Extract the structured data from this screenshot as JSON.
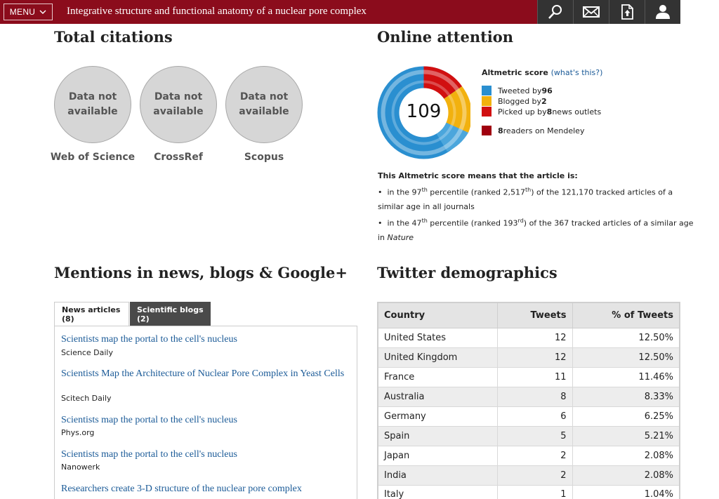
{
  "header": {
    "menu_label": "MENU",
    "title": "Integrative structure and functional anatomy of a nuclear pore complex",
    "icons": [
      "search-icon",
      "mail-icon",
      "download-icon",
      "user-icon"
    ]
  },
  "citations": {
    "heading": "Total citations",
    "items": [
      {
        "value": "Data not available",
        "label": "Web of Science"
      },
      {
        "value": "Data not available",
        "label": "CrossRef"
      },
      {
        "value": "Data not available",
        "label": "Scopus"
      }
    ]
  },
  "attention": {
    "heading": "Online attention",
    "score": "109",
    "score_title": "Altmetric score",
    "whats_this": "(what's this?)",
    "legend": [
      {
        "pre": "Tweeted by ",
        "bold": "96",
        "post": "",
        "color": "#2a8fd0"
      },
      {
        "pre": "Blogged by ",
        "bold": "2",
        "post": "",
        "color": "#f2b10e"
      },
      {
        "pre": "Picked up by ",
        "bold": "8",
        "post": " news outlets",
        "color": "#d10f10"
      },
      {
        "pre": "",
        "bold": "8",
        "post": " readers on Mendeley",
        "color": "#a0000f"
      }
    ],
    "means_title": "This Altmetric score means that the article is:",
    "line1_a": "in the 97",
    "line1_sup1": "th",
    "line1_b": " percentile (ranked 2,517",
    "line1_sup2": "th",
    "line1_c": ") of the 121,170 tracked articles of a",
    "line2": "similar age in all journals",
    "line3_a": "in the 47",
    "line3_sup1": "th",
    "line3_b": " percentile (ranked 193",
    "line3_sup2": "rd",
    "line3_c": ") of the 367 tracked articles of a similar age",
    "line4_a": "in ",
    "line4_b": "Nature"
  },
  "mentions": {
    "heading": "Mentions in news, blogs & Google+",
    "tabs": [
      "News articles (8)",
      "Scientific blogs (2)"
    ],
    "articles": [
      {
        "title": "Scientists map the portal to the cell's nucleus",
        "source": "Science Daily"
      },
      {
        "title": "Scientists Map the Architecture of Nuclear Pore Complex in Yeast Cells",
        "source": "Scitech Daily"
      },
      {
        "title": "Scientists map the portal to the cell's nucleus",
        "source": "Phys.org"
      },
      {
        "title": "Scientists map the portal to the cell's nucleus",
        "source": "Nanowerk"
      },
      {
        "title": "Researchers create 3-D structure of the nuclear pore complex",
        "source": ""
      }
    ]
  },
  "twitter": {
    "heading": "Twitter demographics",
    "columns": [
      "Country",
      "Tweets",
      "% of Tweets"
    ],
    "rows": [
      [
        "United States",
        "12",
        "12.50%"
      ],
      [
        "United Kingdom",
        "12",
        "12.50%"
      ],
      [
        "France",
        "11",
        "11.46%"
      ],
      [
        "Australia",
        "8",
        "8.33%"
      ],
      [
        "Germany",
        "6",
        "6.25%"
      ],
      [
        "Spain",
        "5",
        "5.21%"
      ],
      [
        "Japan",
        "2",
        "2.08%"
      ],
      [
        "India",
        "2",
        "2.08%"
      ],
      [
        "Italy",
        "1",
        "1.04%"
      ]
    ]
  }
}
